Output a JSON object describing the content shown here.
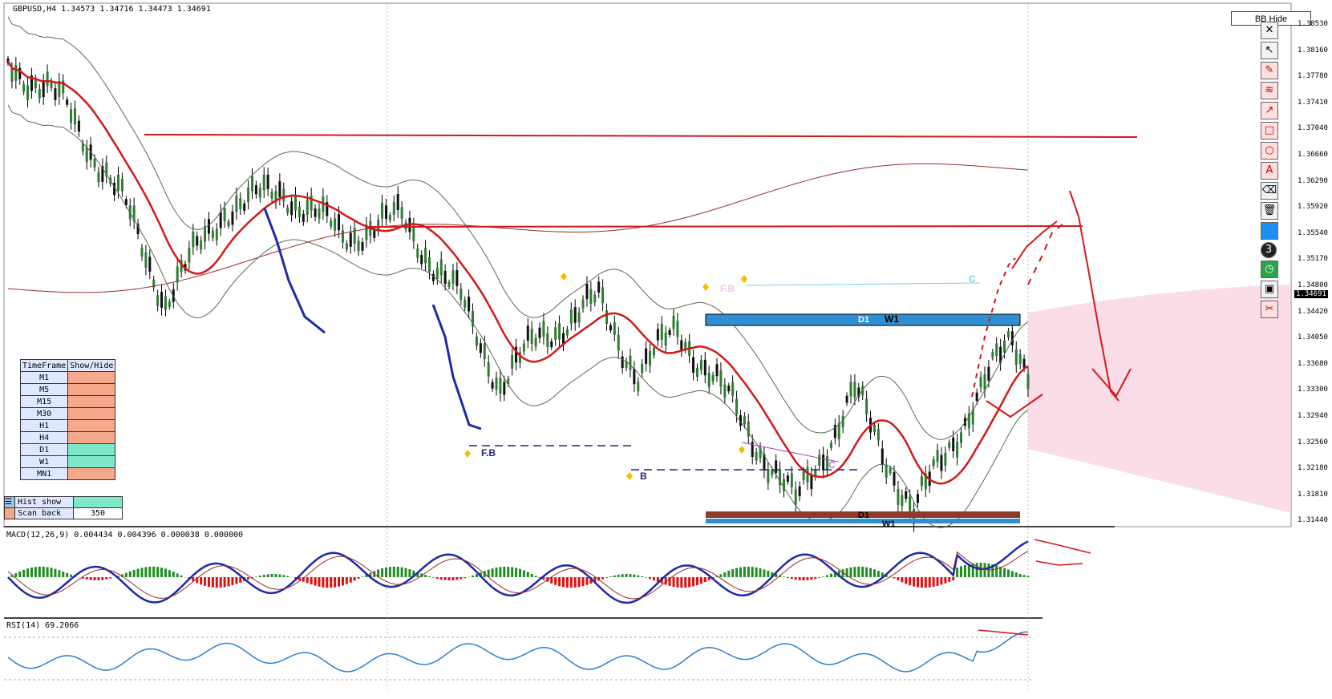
{
  "header": {
    "symbol_line": "GBPUSD,H4  1.34573 1.34716 1.34473 1.34691"
  },
  "macd_label": "MACD(12,26,9) 0.004434 0.004396 0.000038 0.000000",
  "rsi_label": "RSI(14) 69.2066",
  "bb_hide_label": "BB Hide",
  "price_axis": [
    "1.38530",
    "1.38160",
    "1.37780",
    "1.37410",
    "1.37040",
    "1.36660",
    "1.36290",
    "1.35920",
    "1.35540",
    "1.35170",
    "1.34800",
    "1.34420",
    "1.34050",
    "1.33680",
    "1.33300",
    "1.32940",
    "1.32560",
    "1.32180",
    "1.31810",
    "1.31440"
  ],
  "current_price": "1.34691",
  "timeframe_panel": {
    "header_tf": "TimeFrame",
    "header_show": "Show/Hide",
    "rows": [
      {
        "tf": "M1",
        "on": false
      },
      {
        "tf": "M5",
        "on": false
      },
      {
        "tf": "M15",
        "on": false
      },
      {
        "tf": "M30",
        "on": false
      },
      {
        "tf": "H1",
        "on": false
      },
      {
        "tf": "H4",
        "on": false
      },
      {
        "tf": "D1",
        "on": true
      },
      {
        "tf": "W1",
        "on": true
      },
      {
        "tf": "MN1",
        "on": false
      }
    ]
  },
  "hist_panel": {
    "hist_label": "Hist show",
    "scan_label": "Scan back",
    "scan_value": "350"
  },
  "zone_labels": {
    "d1_top": "D1",
    "w1_top": "W1",
    "d1_bottom": "D1",
    "w1_bottom": "W1"
  },
  "pattern_labels": {
    "fb1": "F.B",
    "b1": "B",
    "fb2": "F.B",
    "c1": "C",
    "c2": "C"
  },
  "toolbar": [
    "close",
    "cursor",
    "pen",
    "fib",
    "arrow",
    "rectangle",
    "ellipse",
    "text",
    "eraser",
    "trash",
    "color",
    "3",
    "clock",
    "save",
    "scissors"
  ],
  "colors": {
    "ma_red": "#d41818",
    "bb_green": "#556b55",
    "macd_blue": "#1c2aa8",
    "rsi_blue": "#2c7fd0",
    "hist_green": "#218c21",
    "hist_red": "#e01010",
    "zone_blue": "#2f8fd2",
    "zone_brown": "#8a3b2a",
    "vol_pink": "#f7c6d8",
    "tf_on": "#7fe8c8",
    "tf_off": "#f4a98a"
  }
}
